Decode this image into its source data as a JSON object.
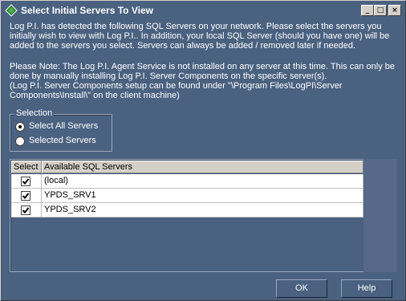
{
  "window": {
    "title": "Select Initial Servers To View",
    "controls": {
      "minimize": "_",
      "maximize": "□",
      "close": "×"
    }
  },
  "description": {
    "paragraph1": "Log P.I. has detected the following SQL Servers on your network. Please select the servers you initially wish to view with Log P.I.. In addition, your local SQL Server (should you have one) will be added to the servers you select. Servers can always be added / removed later if needed.",
    "paragraph2_line1": "Please Note: The Log P.I. Agent Service is not installed on any server at this time.  This can only be done by manually installing Log P.I. Server Components on the specific server(s).",
    "paragraph2_line2": "(Log P.I. Server Components setup can be found under \"\\Program Files\\LogPI\\Server Components\\Install\\\" on the client machine)"
  },
  "selection": {
    "label": "Selection",
    "options": [
      {
        "label": "Select All Servers",
        "selected": true
      },
      {
        "label": "Selected Servers",
        "selected": false
      }
    ]
  },
  "grid": {
    "headers": {
      "select": "Select",
      "server": "Available SQL Servers"
    },
    "rows": [
      {
        "checked": true,
        "name": "(local)"
      },
      {
        "checked": true,
        "name": "YPDS_SRV1"
      },
      {
        "checked": true,
        "name": "YPDS_SRV2"
      }
    ]
  },
  "buttons": {
    "ok": "OK",
    "help": "Help"
  },
  "icons": {
    "title_icon": "diamond-app-icon",
    "check": "checkmark-icon"
  }
}
